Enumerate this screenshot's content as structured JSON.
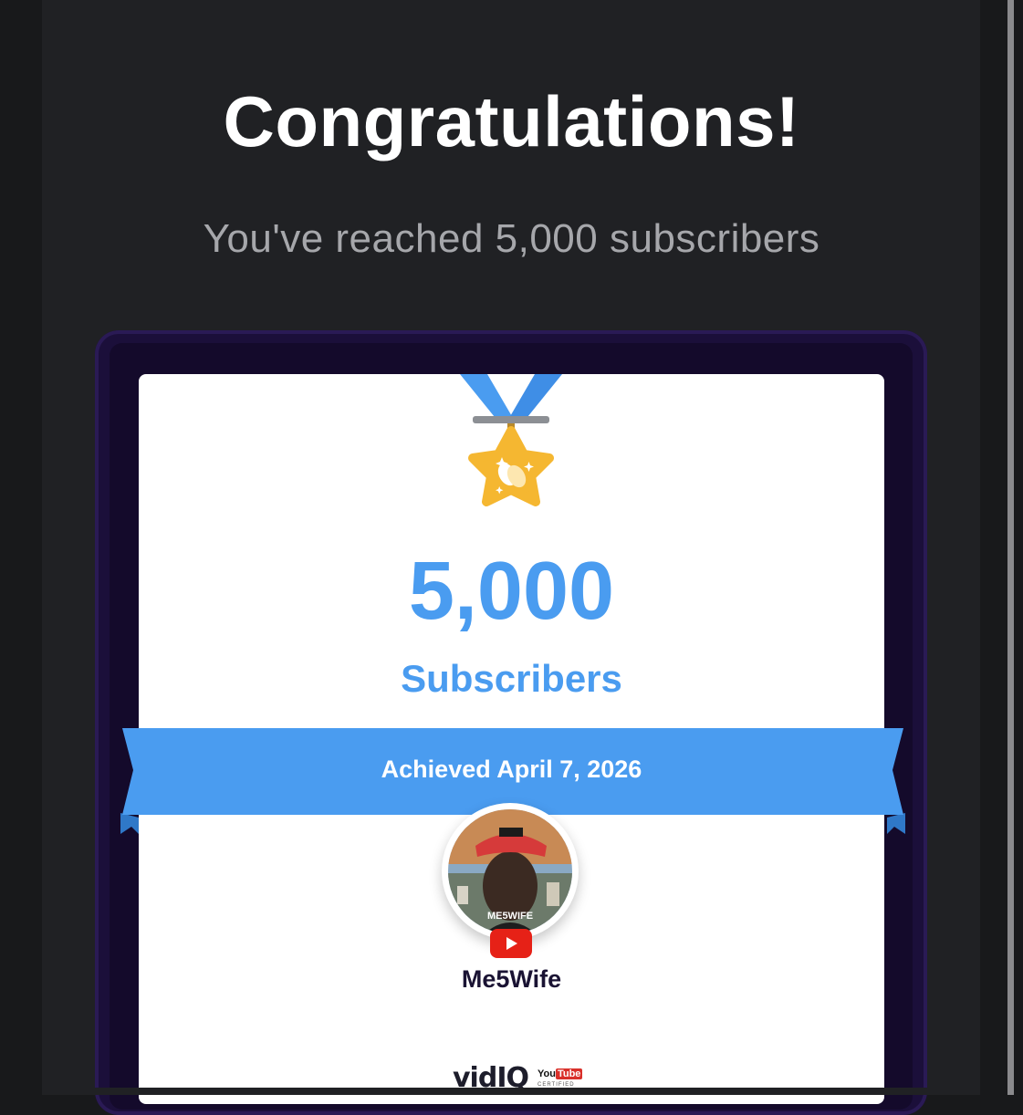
{
  "header": {
    "title": "Congratulations!",
    "subtitle": "You've reached 5,000 subscribers"
  },
  "certificate": {
    "count": "5,000",
    "unit_label": "Subscribers",
    "ribbon_text": "Achieved April 7, 2026",
    "channel_name": "Me5Wife",
    "avatar_overlay_text": "ME5WIFE",
    "medal_icon": "star-medal-clapping-hands-icon"
  },
  "footer": {
    "brand": "vidIQ",
    "partner_you": "You",
    "partner_tube": "Tube",
    "partner_caption": "CERTIFIED"
  },
  "colors": {
    "accent_blue": "#4a9cf0",
    "frame_purple": "#1b0f3a",
    "panel_bg": "#202124",
    "medal_gold": "#f5b731",
    "youtube_red": "#e62117"
  }
}
